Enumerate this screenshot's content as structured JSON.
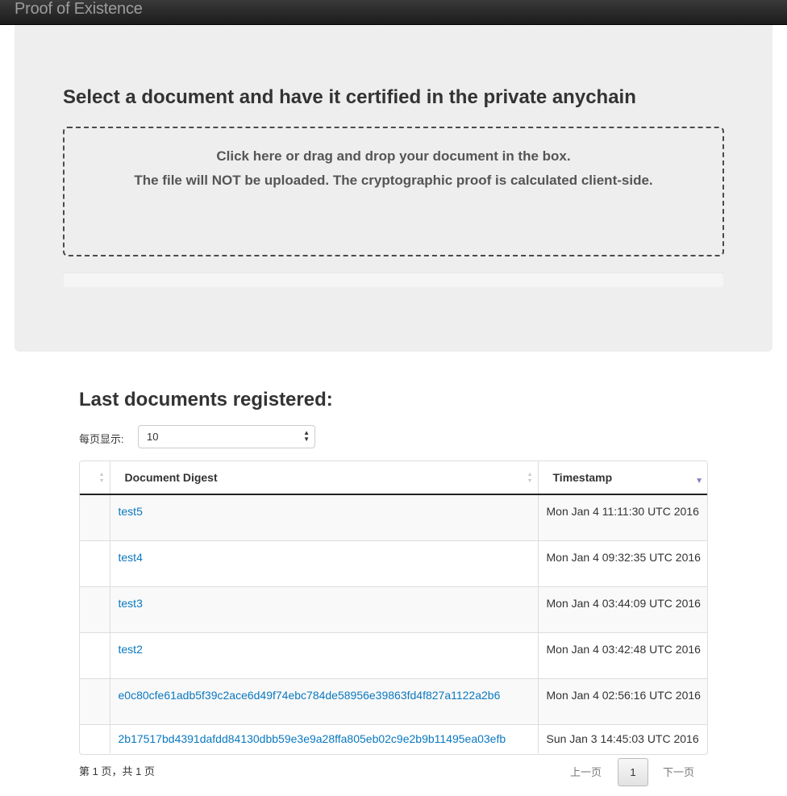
{
  "navbar": {
    "brand": "Proof of Existence"
  },
  "jumbotron": {
    "title": "Select a document and have it certified in the private anychain",
    "dropzone_line1": "Click here or drag and drop your document in the box.",
    "dropzone_line2": "The file will NOT be uploaded. The cryptographic proof is calculated client-side.",
    "progress_fraction": 0
  },
  "registry": {
    "title": "Last documents registered:",
    "length_label": "每页显示:",
    "length_value": "10",
    "columns": [
      "",
      "Document Digest",
      "Timestamp"
    ],
    "sort": {
      "column": "Timestamp",
      "direction": "desc"
    },
    "rows": [
      {
        "digest": "test5",
        "timestamp": "Mon Jan 4 11:11:30 UTC 2016"
      },
      {
        "digest": "test4",
        "timestamp": "Mon Jan 4 09:32:35 UTC 2016"
      },
      {
        "digest": "test3",
        "timestamp": "Mon Jan 4 03:44:09 UTC 2016"
      },
      {
        "digest": "test2",
        "timestamp": "Mon Jan 4 03:42:48 UTC 2016"
      },
      {
        "digest": "e0c80cfe61adb5f39c2ace6d49f74ebc784de58956e39863fd4f827a1122a2b6",
        "timestamp": "Mon Jan 4 02:56:16 UTC 2016"
      },
      {
        "digest": "2b17517bd4391dafdd84130dbb59e3e9a28ffa805eb02c9e2b9b11495ea03efb",
        "timestamp": "Sun Jan 3 14:45:03 UTC 2016"
      }
    ],
    "info": "第 1 页，共 1 页",
    "pager": {
      "prev": "上一页",
      "current": "1",
      "next": "下一页"
    }
  },
  "colors": {
    "link": "#0a78c0",
    "jumbotron_bg": "#eeeeee",
    "navbar_bg": "#1b1b1b"
  }
}
